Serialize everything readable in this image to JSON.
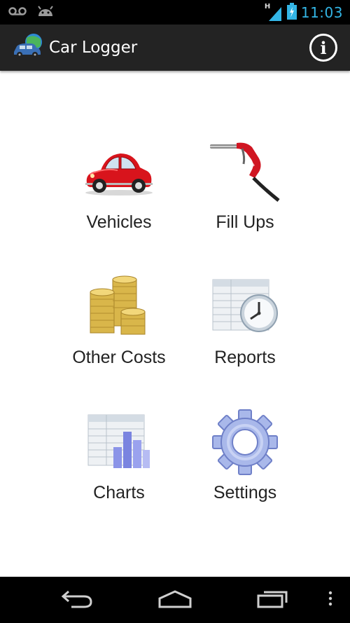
{
  "status_bar": {
    "time": "11:03",
    "network_type": "H",
    "icons": [
      "voicemail-icon",
      "android-icon",
      "signal-icon",
      "battery-charging-icon"
    ]
  },
  "action_bar": {
    "title": "Car Logger",
    "logo_icon": "car-logo-icon",
    "info_icon": "info-icon",
    "info_glyph": "i"
  },
  "menu": {
    "items": [
      {
        "label": "Vehicles",
        "icon": "red-car-icon"
      },
      {
        "label": "Fill Ups",
        "icon": "fuel-nozzle-icon"
      },
      {
        "label": "Other Costs",
        "icon": "coins-icon"
      },
      {
        "label": "Reports",
        "icon": "report-clock-icon"
      },
      {
        "label": "Charts",
        "icon": "bar-chart-icon"
      },
      {
        "label": "Settings",
        "icon": "gear-icon"
      }
    ]
  },
  "navigation_bar": {
    "icons": [
      "back-icon",
      "home-icon",
      "recent-apps-icon",
      "overflow-menu-icon"
    ]
  },
  "colors": {
    "status_accent": "#33b5e5",
    "action_bar_bg": "#232323",
    "text": "#222222"
  }
}
